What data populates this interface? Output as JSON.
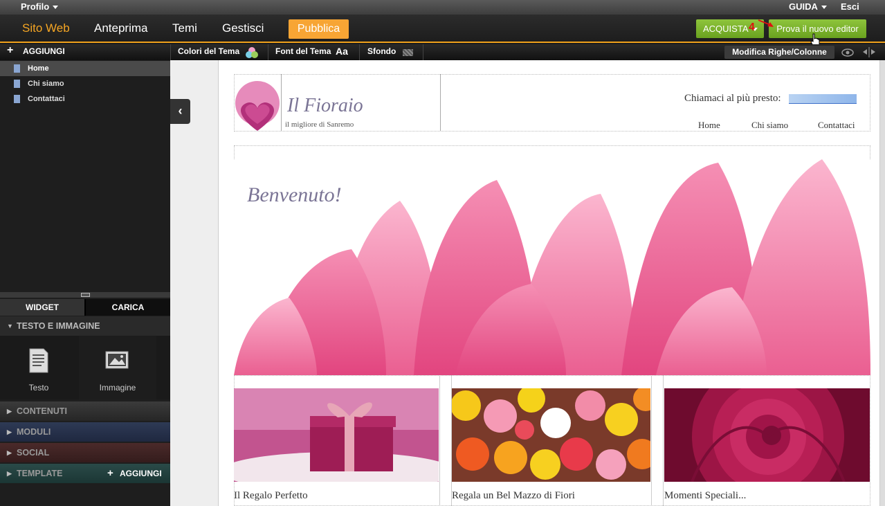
{
  "topbar": {
    "profile": "Profilo",
    "help": "GUIDA",
    "logout": "Esci"
  },
  "nav": {
    "items": [
      "Sito Web",
      "Anteprima",
      "Temi",
      "Gestisci"
    ],
    "publish": "Pubblica",
    "buy": "ACQUISTA",
    "try_editor": "Prova il nuovo editor",
    "step_badge": "4"
  },
  "toolbar": {
    "add": "AGGIUNGI",
    "theme_colors": "Colori del Tema",
    "theme_font": "Font del Tema",
    "font_glyph": "Aa",
    "background": "Sfondo",
    "edit_rows_cols": "Modifica Righe/Colonne"
  },
  "pages": [
    "Home",
    "Chi siamo",
    "Contattaci"
  ],
  "panel": {
    "tab_widget": "WIDGET",
    "tab_upload": "CARICA",
    "section_text_image": "TESTO E IMMAGINE",
    "widget_text": "Testo",
    "widget_image": "Immagine",
    "sections": [
      "CONTENUTI",
      "MODULI",
      "SOCIAL",
      "TEMPLATE"
    ],
    "template_add": "AGGIUNGI"
  },
  "site": {
    "title": "Il Fioraio",
    "subtitle": "il migliore di Sanremo",
    "phone_label": "Chiamaci al più presto:",
    "nav": [
      "Home",
      "Chi siamo",
      "Contattaci"
    ],
    "welcome": "Benvenuto!",
    "cards": [
      "Il Regalo Perfetto",
      "Regala un Bel Mazzo di Fiori",
      "Momenti Speciali..."
    ]
  },
  "colors": {
    "accent": "#f6a623",
    "green": "#7cb32c",
    "sidebar": "#1e1e1e",
    "brand_purple": "#7a7495"
  }
}
